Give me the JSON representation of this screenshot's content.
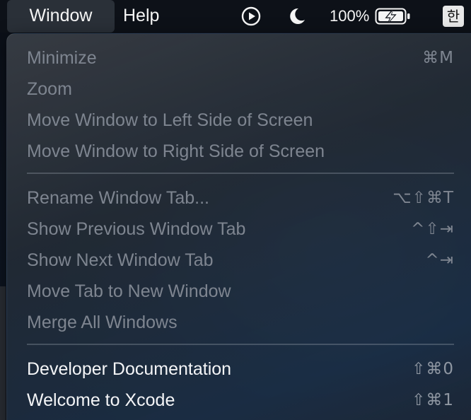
{
  "menubar": {
    "window_label": "Window",
    "help_label": "Help",
    "battery_percent": "100%",
    "input_method": "한"
  },
  "menu": {
    "groups": [
      [
        {
          "label": "Minimize",
          "shortcut": "⌘M",
          "enabled": false
        },
        {
          "label": "Zoom",
          "shortcut": "",
          "enabled": false
        },
        {
          "label": "Move Window to Left Side of Screen",
          "shortcut": "",
          "enabled": false
        },
        {
          "label": "Move Window to Right Side of Screen",
          "shortcut": "",
          "enabled": false
        }
      ],
      [
        {
          "label": "Rename Window Tab...",
          "shortcut": "⌥⇧⌘T",
          "enabled": false
        },
        {
          "label": "Show Previous Window Tab",
          "shortcut": "^⇧⇥",
          "enabled": false
        },
        {
          "label": "Show Next Window Tab",
          "shortcut": "^⇥",
          "enabled": false
        },
        {
          "label": "Move Tab to New Window",
          "shortcut": "",
          "enabled": false
        },
        {
          "label": "Merge All Windows",
          "shortcut": "",
          "enabled": false
        }
      ],
      [
        {
          "label": "Developer Documentation",
          "shortcut": "⇧⌘0",
          "enabled": true
        },
        {
          "label": "Welcome to Xcode",
          "shortcut": "⇧⌘1",
          "enabled": true
        }
      ]
    ]
  },
  "colors": {
    "menubar_bg": "#0d1118",
    "disabled_text": "#7e8590",
    "enabled_text": "#f4f5f7"
  }
}
